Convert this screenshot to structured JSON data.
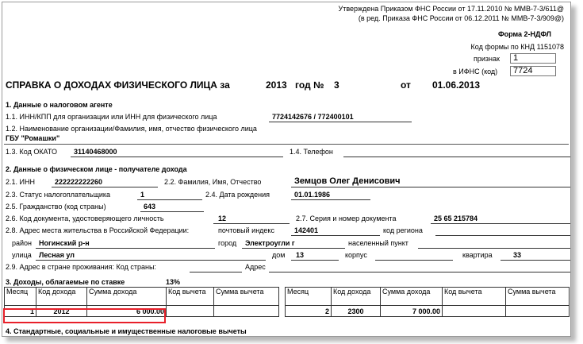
{
  "header": {
    "approved_line": "Утверждена Приказом ФНС России от 17.11.2010 № ММВ-7-3/611@",
    "edition_line": "(в ред. Приказа ФНС России от 06.12.2011 № ММВ-7-3/909@)",
    "form_name": "Форма 2-НДФЛ",
    "knd_label": "Код формы по КНД 1151078",
    "sign_label": "признак",
    "sign_value": "1",
    "ifns_label": "в ИФНС (код)",
    "ifns_value": "7724"
  },
  "title": {
    "text": "СПРАВКА О ДОХОДАХ ФИЗИЧЕСКОГО ЛИЦА за",
    "year": "2013",
    "year_label": "год №",
    "number": "3",
    "from_label": "от",
    "date": "01.06.2013"
  },
  "section1": {
    "heading": "1. Данные о налоговом агенте",
    "inn_label": "1.1. ИНН/КПП для организации или ИНН для физического лица",
    "inn_value": "7724142676 / 772400101",
    "name_label": "1.2. Наименование организации/Фамилия, имя, отчество физического лица",
    "name_value": "ГБУ \"Ромашки\"",
    "okato_label": "1.3. Код ОКАТО",
    "okato_value": "31140468000",
    "phone_label": "1.4. Телефон"
  },
  "section2": {
    "heading": "2. Данные о физическом лице - получателе дохода",
    "inn_label": "2.1. ИНН",
    "inn_value": "222222222260",
    "fio_label": "2.2. Фамилия, Имя, Отчество",
    "fio_value": "Земцов Олег Денисович",
    "status_label": "2.3. Статус налогоплательщика",
    "status_value": "1",
    "birth_label": "2.4. Дата рождения",
    "birth_value": "01.01.1986",
    "citizenship_label": "2.5. Гражданство (код страны)",
    "citizenship_value": "643",
    "doc_code_label": "2.6. Код документа, удостоверяющего личность",
    "doc_code_value": "12",
    "doc_series_label": "2.7. Серия и номер документа",
    "doc_series_value": "25 65 215784",
    "address_label": "2.8. Адрес места жительства в Российской Федерации:",
    "zip_label": "почтовый индекс",
    "zip_value": "142401",
    "region_label": "код региона",
    "district_label": "район",
    "district_value": "Ногинский р-н",
    "city_label": "город",
    "city_value": "Электроугли г",
    "settlement_label": "населенный пункт",
    "street_label": "улица",
    "street_value": "Лесная ул",
    "house_label": "дом",
    "house_value": "13",
    "block_label": "корпус",
    "flat_label": "квартира",
    "flat_value": "33",
    "foreign_label": "2.9. Адрес в стране проживания: Код страны:",
    "foreign_address_label": "Адрес"
  },
  "section3": {
    "heading": "3. Доходы, облагаемые по ставке",
    "rate": "13%",
    "columns": [
      "Месяц",
      "Код дохода",
      "Сумма дохода",
      "Код вычета",
      "Сумма вычета"
    ],
    "left_rows": [
      {
        "month": "1",
        "code": "2012",
        "amount": "6 000.00",
        "ded_code": "",
        "ded_amount": ""
      }
    ],
    "right_rows": [
      {
        "month": "2",
        "code": "2300",
        "amount": "7 000.00",
        "ded_code": "",
        "ded_amount": ""
      }
    ]
  },
  "section4": {
    "heading": "4. Стандартные, социальные и имущественные налоговые вычеты"
  },
  "colors": {
    "highlight": "#e8202a"
  }
}
